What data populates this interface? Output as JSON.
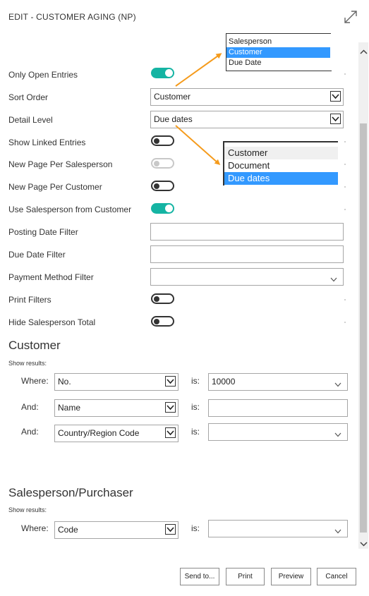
{
  "window": {
    "title": "EDIT - CUSTOMER AGING (NP)"
  },
  "options": {
    "only_open_entries": {
      "label": "Only Open Entries",
      "value": true
    },
    "sort_order": {
      "label": "Sort Order",
      "value": "Customer"
    },
    "detail_level": {
      "label": "Detail Level",
      "value": "Due dates"
    },
    "show_linked_entries": {
      "label": "Show Linked Entries",
      "value": false
    },
    "new_page_per_salesperson": {
      "label": "New Page Per Salesperson",
      "value": false,
      "disabled": true
    },
    "new_page_per_customer": {
      "label": "New Page Per Customer",
      "value": false
    },
    "use_salesperson_from_customer": {
      "label": "Use Salesperson from Customer",
      "value": true
    },
    "posting_date_filter": {
      "label": "Posting Date Filter",
      "value": ""
    },
    "due_date_filter": {
      "label": "Due Date Filter",
      "value": ""
    },
    "payment_method_filter": {
      "label": "Payment Method Filter",
      "value": ""
    },
    "print_filters": {
      "label": "Print Filters",
      "value": false
    },
    "hide_salesperson_total": {
      "label": "Hide Salesperson Total",
      "value": false
    }
  },
  "sort_order_popup": {
    "items": [
      "Salesperson",
      "Customer",
      "Due Date"
    ],
    "selected": "Customer"
  },
  "detail_level_popup": {
    "items": [
      "Customer",
      "Document",
      "Due dates"
    ],
    "selected": "Due dates",
    "hover": "Customer"
  },
  "customer_section": {
    "title": "Customer",
    "show_results": "Show results:",
    "filters": [
      {
        "connector": "Where:",
        "field": "No.",
        "is_label": "is:",
        "value": "10000"
      },
      {
        "connector": "And:",
        "field": "Name",
        "is_label": "is:",
        "value": ""
      },
      {
        "connector": "And:",
        "field": "Country/Region Code",
        "is_label": "is:",
        "value": ""
      }
    ]
  },
  "salesperson_section": {
    "title": "Salesperson/Purchaser",
    "show_results": "Show results:",
    "filters": [
      {
        "connector": "Where:",
        "field": "Code",
        "is_label": "is:",
        "value": ""
      }
    ]
  },
  "footer": {
    "send_to": "Send to...",
    "print": "Print",
    "preview": "Preview",
    "cancel": "Cancel"
  },
  "colors": {
    "toggle_on": "#15b4a3",
    "highlight": "#3399ff",
    "annotation_arrow": "#f59b1c"
  }
}
